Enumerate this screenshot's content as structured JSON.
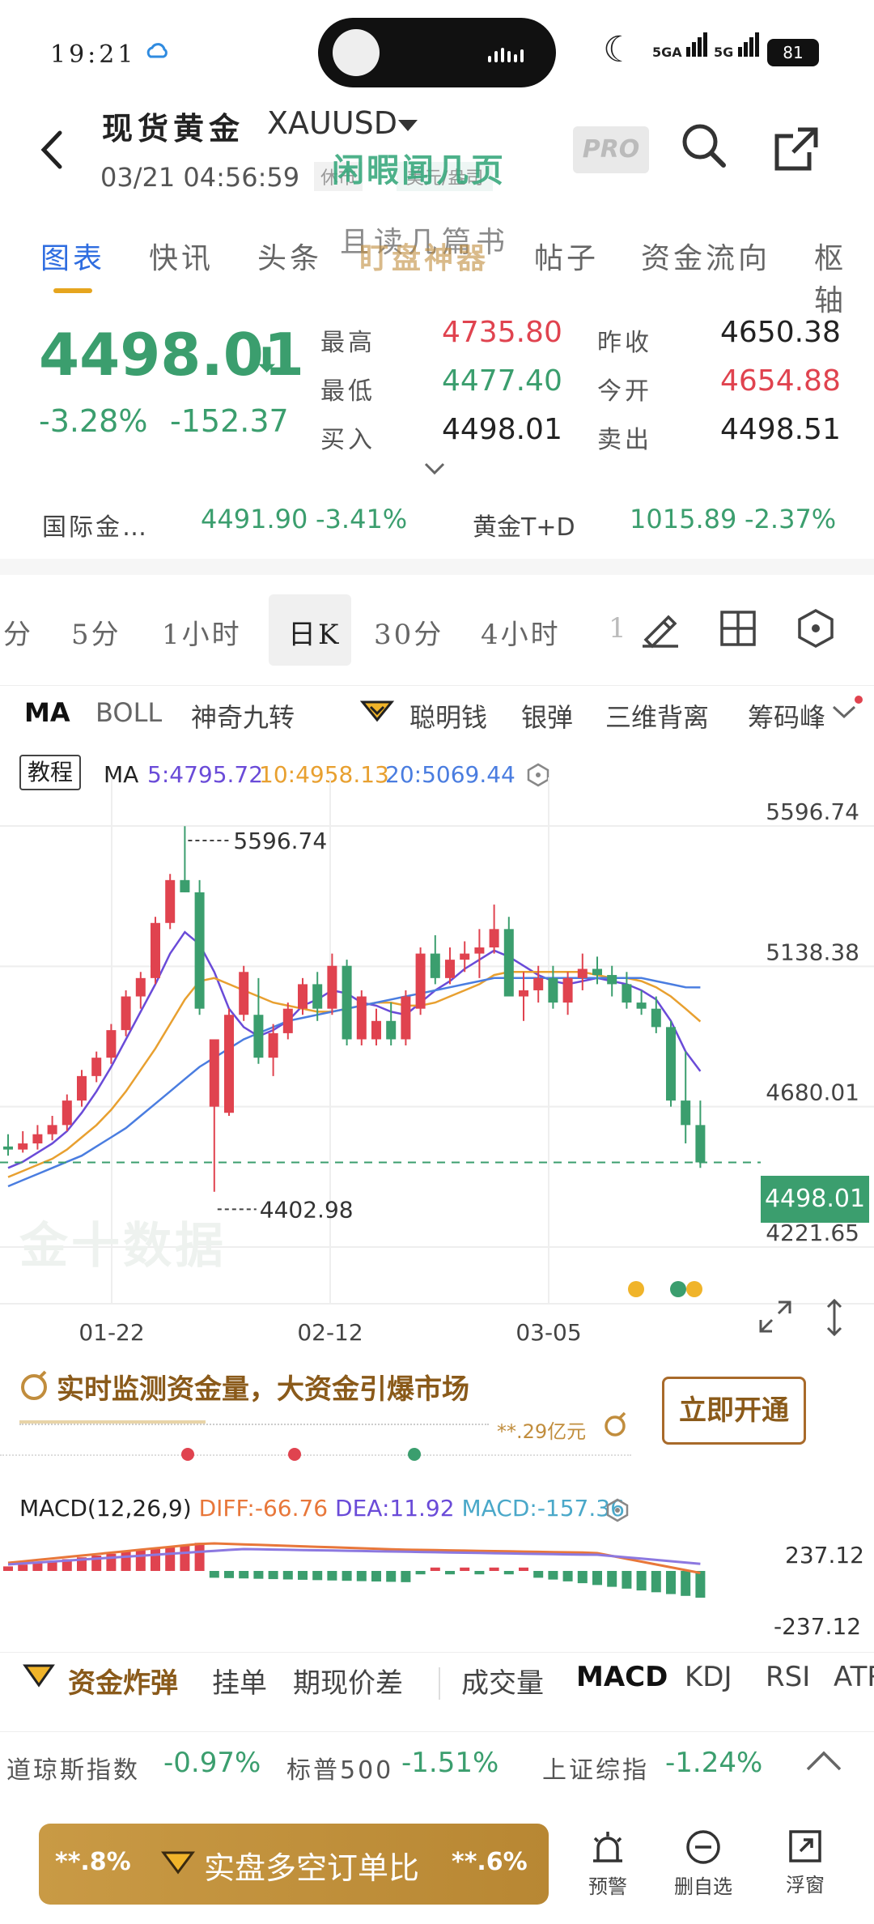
{
  "status_bar": {
    "time": "19:21",
    "network1": "5GA",
    "network2": "5G",
    "battery": "81"
  },
  "header": {
    "title": "现货黄金",
    "code": "XAUUSD",
    "timestamp": "03/21 04:56:59",
    "badge1": "休市",
    "badge2": "美元/盎司",
    "pro_label": "PRO",
    "overlay_text1": "闲暇闻几页",
    "overlay_text2": "且读几篇书"
  },
  "tabs": [
    "图表",
    "快讯",
    "头条",
    "盯盘神器",
    "帖子",
    "资金流向",
    "枢轴"
  ],
  "quote": {
    "price": "4498.01",
    "change_pct": "-3.28%",
    "change_abs": "-152.37",
    "high_label": "最高",
    "high": "4735.80",
    "low_label": "最低",
    "low": "4477.40",
    "bid_label": "买入",
    "bid": "4498.01",
    "prev_close_label": "昨收",
    "prev_close": "4650.38",
    "open_label": "今开",
    "open": "4654.88",
    "ask_label": "卖出",
    "ask": "4498.51"
  },
  "related": {
    "item1_name": "国际金…",
    "item1_price": "4491.90",
    "item1_pct": "-3.41%",
    "item2_name": "黄金T+D",
    "item2_price": "1015.89",
    "item2_pct": "-2.37%"
  },
  "timeframes": [
    "分",
    "5分",
    "1小时",
    "日K",
    "30分",
    "4小时",
    "1"
  ],
  "indicators": [
    "MA",
    "BOLL",
    "神奇九转",
    "聪明钱",
    "银弹",
    "三维背离",
    "筹码峰"
  ],
  "ma_legend": {
    "tutorial": "教程",
    "label": "MA",
    "ma5": "5:4795.72",
    "ma10": "10:4958.13",
    "ma20": "20:5069.44"
  },
  "chart_data": {
    "type": "candlestick",
    "y_ticks": [
      "5596.74",
      "5138.38",
      "4680.01",
      "4221.65"
    ],
    "x_ticks": [
      "01-22",
      "02-12",
      "03-05"
    ],
    "max_label": "5596.74",
    "min_label": "4402.98",
    "current_price": "4498.01",
    "ylim": [
      4221.65,
      5596.74
    ],
    "candles": [
      [
        4550,
        4590,
        4520,
        4540
      ],
      [
        4540,
        4600,
        4530,
        4560
      ],
      [
        4560,
        4620,
        4540,
        4590
      ],
      [
        4590,
        4650,
        4570,
        4620
      ],
      [
        4620,
        4720,
        4600,
        4700
      ],
      [
        4700,
        4800,
        4680,
        4780
      ],
      [
        4780,
        4860,
        4760,
        4840
      ],
      [
        4840,
        4950,
        4820,
        4930
      ],
      [
        4930,
        5060,
        4910,
        5040
      ],
      [
        5040,
        5120,
        5000,
        5100
      ],
      [
        5100,
        5300,
        5080,
        5280
      ],
      [
        5280,
        5440,
        5260,
        5420
      ],
      [
        5420,
        5596,
        5380,
        5380
      ],
      [
        5380,
        5420,
        4980,
        5000
      ],
      [
        4680,
        4900,
        4402,
        4900
      ],
      [
        4660,
        5000,
        4650,
        4980
      ],
      [
        4980,
        5140,
        4960,
        5120
      ],
      [
        4980,
        5100,
        4820,
        4840
      ],
      [
        4840,
        4950,
        4780,
        4920
      ],
      [
        4920,
        5020,
        4900,
        5000
      ],
      [
        5000,
        5100,
        4980,
        5080
      ],
      [
        5080,
        5120,
        4960,
        5000
      ],
      [
        5000,
        5180,
        4980,
        5140
      ],
      [
        5140,
        5160,
        4880,
        4900
      ],
      [
        4900,
        5060,
        4880,
        5040
      ],
      [
        4900,
        5000,
        4880,
        4960
      ],
      [
        4960,
        5020,
        4880,
        4900
      ],
      [
        4900,
        5060,
        4880,
        5040
      ],
      [
        5000,
        5200,
        4980,
        5180
      ],
      [
        5180,
        5240,
        5080,
        5100
      ],
      [
        5100,
        5200,
        5080,
        5160
      ],
      [
        5160,
        5220,
        5120,
        5180
      ],
      [
        5180,
        5260,
        5100,
        5200
      ],
      [
        5200,
        5340,
        5180,
        5260
      ],
      [
        5260,
        5300,
        5040,
        5040
      ],
      [
        5040,
        5120,
        4960,
        5060
      ],
      [
        5060,
        5140,
        5020,
        5100
      ],
      [
        5100,
        5140,
        5000,
        5020
      ],
      [
        5020,
        5120,
        4980,
        5100
      ],
      [
        5100,
        5180,
        5060,
        5130
      ],
      [
        5130,
        5170,
        5080,
        5110
      ],
      [
        5110,
        5140,
        5040,
        5080
      ],
      [
        5080,
        5120,
        5000,
        5020
      ],
      [
        5020,
        5060,
        4980,
        5000
      ],
      [
        5000,
        5040,
        4920,
        4940
      ],
      [
        4940,
        4960,
        4680,
        4700
      ],
      [
        4700,
        4860,
        4560,
        4620
      ],
      [
        4620,
        4700,
        4480,
        4498
      ]
    ],
    "series": [
      {
        "name": "MA5",
        "values": [
          4480,
          4500,
          4530,
          4560,
          4600,
          4660,
          4730,
          4810,
          4900,
          4990,
          5080,
          5180,
          5250,
          5210,
          5120,
          5000,
          4940,
          4910,
          4930,
          4960,
          5010,
          5030,
          5060,
          5050,
          5020,
          5010,
          4990,
          4980,
          5020,
          5060,
          5090,
          5130,
          5160,
          5190,
          5170,
          5140,
          5110,
          5090,
          5080,
          5090,
          5100,
          5090,
          5080,
          5060,
          5030,
          4960,
          4860,
          4795.72
        ]
      },
      {
        "name": "MA10",
        "values": [
          4450,
          4470,
          4490,
          4510,
          4540,
          4580,
          4620,
          4670,
          4730,
          4800,
          4870,
          4950,
          5030,
          5090,
          5100,
          5080,
          5060,
          5040,
          5020,
          5010,
          5000,
          4990,
          4990,
          5000,
          5010,
          5020,
          5020,
          5010,
          5010,
          5020,
          5040,
          5060,
          5080,
          5110,
          5120,
          5120,
          5120,
          5120,
          5120,
          5120,
          5110,
          5100,
          5100,
          5090,
          5070,
          5040,
          5000,
          4958.13
        ]
      },
      {
        "name": "MA20",
        "values": [
          4420,
          4440,
          4460,
          4480,
          4500,
          4520,
          4550,
          4580,
          4610,
          4650,
          4690,
          4730,
          4770,
          4810,
          4840,
          4870,
          4900,
          4920,
          4940,
          4960,
          4970,
          4980,
          4990,
          5000,
          5010,
          5020,
          5030,
          5040,
          5050,
          5060,
          5070,
          5080,
          5090,
          5100,
          5100,
          5100,
          5100,
          5100,
          5100,
          5100,
          5100,
          5100,
          5100,
          5100,
          5090,
          5080,
          5070,
          5069.44
        ]
      }
    ]
  },
  "promo": {
    "title": "实时监测资金量，大资金引爆市场",
    "amount": "**.29亿元",
    "button": "立即开通"
  },
  "macd": {
    "label": "MACD(12,26,9)",
    "diff": "DIFF:-66.76",
    "dea": "DEA:11.92",
    "macd": "MACD:-157.36",
    "top": "237.12",
    "bottom": "-237.12"
  },
  "bottom_tabs": [
    "资金炸弹",
    "挂单",
    "期现价差",
    "成交量",
    "MACD",
    "KDJ",
    "RSI",
    "ATR"
  ],
  "indices": {
    "dow_name": "道琼斯指数",
    "dow_pct": "-0.97%",
    "sp_name": "标普500",
    "sp_pct": "-1.51%",
    "sh_name": "上证综指",
    "sh_pct": "-1.24%"
  },
  "footer": {
    "left_pct": "**.8%",
    "button": "实盘多空订单比",
    "right_pct": "**.6%",
    "tool1": "预警",
    "tool2": "删自选",
    "tool3": "浮窗"
  },
  "colors": {
    "up": "#e0434f",
    "down": "#3b9e6e",
    "ma5": "#6a4bd8",
    "ma10": "#e8a030",
    "ma20": "#4a7de0",
    "accent": "#2f6de0",
    "gold": "#c18d3d"
  }
}
